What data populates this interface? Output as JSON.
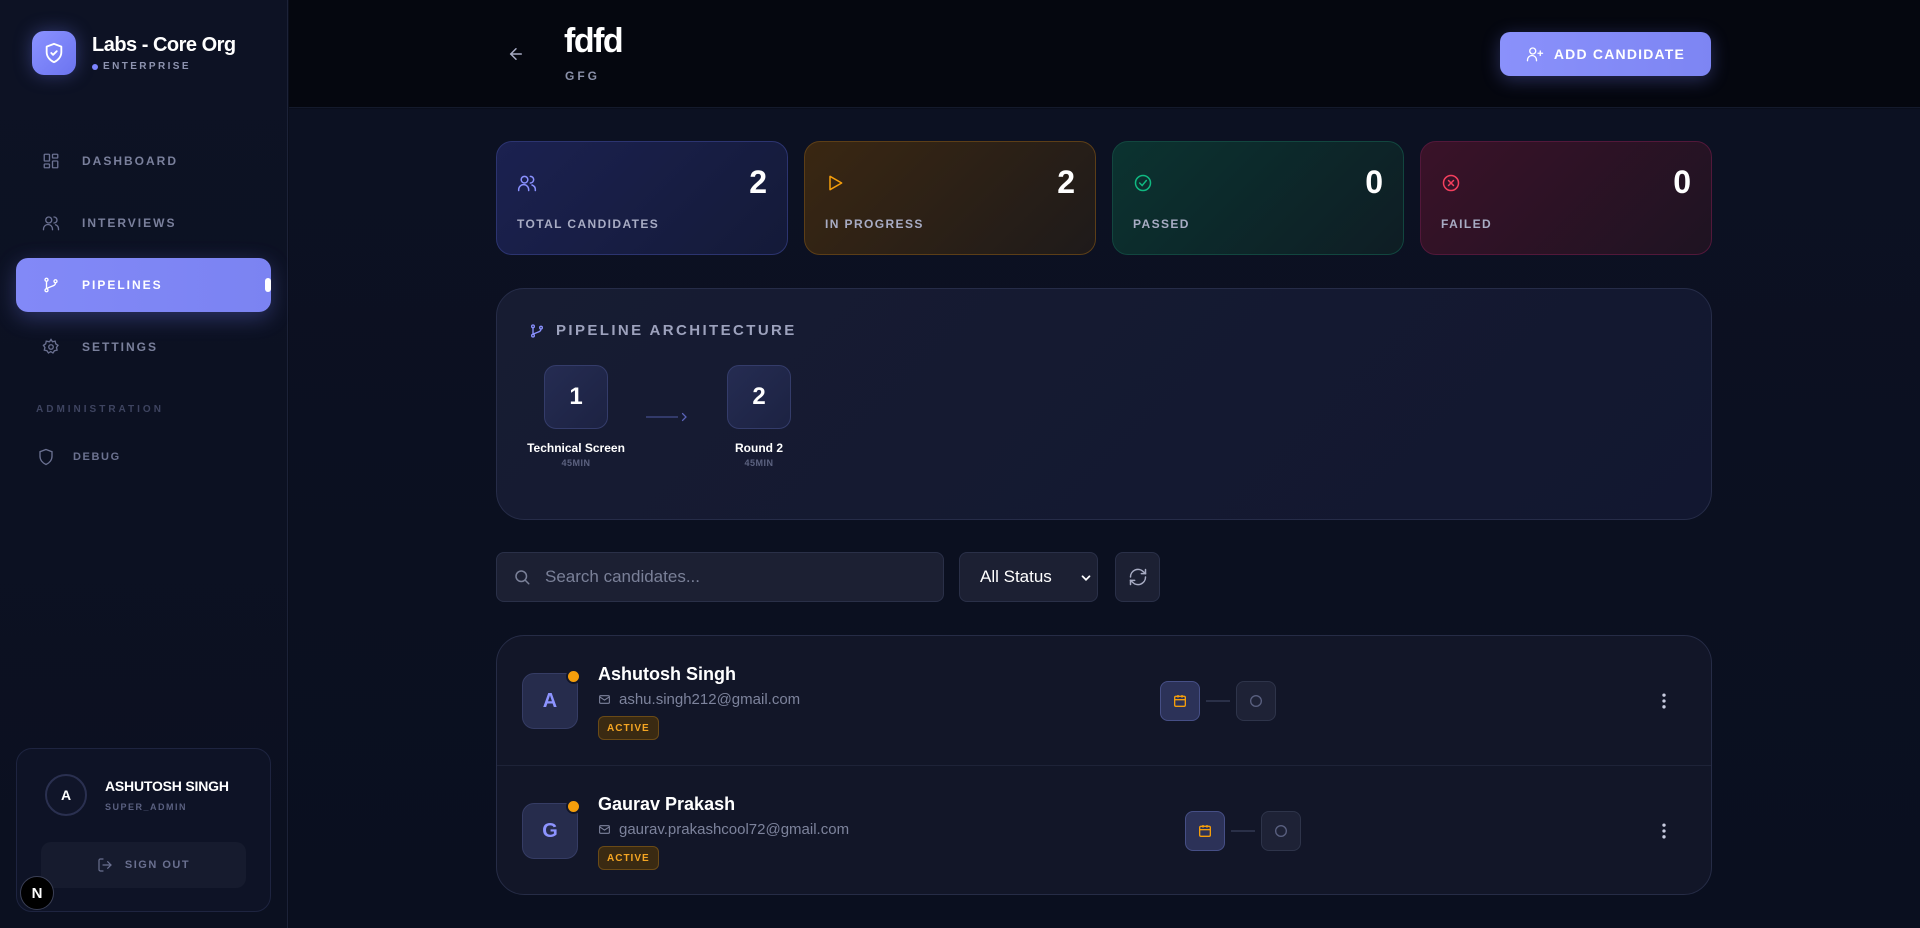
{
  "brand": {
    "name": "Labs - Core Org",
    "tier": "ENTERPRISE"
  },
  "nav": [
    {
      "label": "DASHBOARD",
      "icon": "grid-icon",
      "active": false
    },
    {
      "label": "INTERVIEWS",
      "icon": "users-icon",
      "active": false
    },
    {
      "label": "PIPELINES",
      "icon": "git-branch-icon",
      "active": true
    },
    {
      "label": "SETTINGS",
      "icon": "gear-icon",
      "active": false
    }
  ],
  "admin": {
    "section_label": "ADMINISTRATION",
    "debug_label": "DEBUG"
  },
  "user": {
    "initial": "A",
    "name": "ASHUTOSH SINGH",
    "role": "SUPER_ADMIN",
    "signout_label": "SIGN OUT"
  },
  "dev_badge": "N",
  "header": {
    "title": "fdfd",
    "subtitle": "GFG",
    "add_label": "ADD CANDIDATE"
  },
  "stats": [
    {
      "label": "TOTAL CANDIDATES",
      "value": "2",
      "icon": "users-icon",
      "color": "#8a91ff"
    },
    {
      "label": "IN PROGRESS",
      "value": "2",
      "icon": "play-icon",
      "color": "#f59e0b"
    },
    {
      "label": "PASSED",
      "value": "0",
      "icon": "check-circle-icon",
      "color": "#10b981"
    },
    {
      "label": "FAILED",
      "value": "0",
      "icon": "x-circle-icon",
      "color": "#f43f5e"
    }
  ],
  "architecture": {
    "title": "PIPELINE ARCHITECTURE",
    "stages": [
      {
        "number": "1",
        "name": "Technical Screen",
        "duration": "45MIN"
      },
      {
        "number": "2",
        "name": "Round 2",
        "duration": "45MIN"
      }
    ]
  },
  "filters": {
    "search_placeholder": "Search candidates...",
    "status_value": "All Status"
  },
  "candidates": [
    {
      "initial": "A",
      "name": "Ashutosh Singh",
      "email": "ashu.singh212@gmail.com",
      "status": "ACTIVE"
    },
    {
      "initial": "G",
      "name": "Gaurav Prakash",
      "email": "gaurav.prakashcool72@gmail.com",
      "status": "ACTIVE"
    }
  ],
  "colors": {
    "accent": "#7f87f5",
    "warning": "#f59e0b",
    "success": "#10b981",
    "danger": "#f43f5e"
  }
}
